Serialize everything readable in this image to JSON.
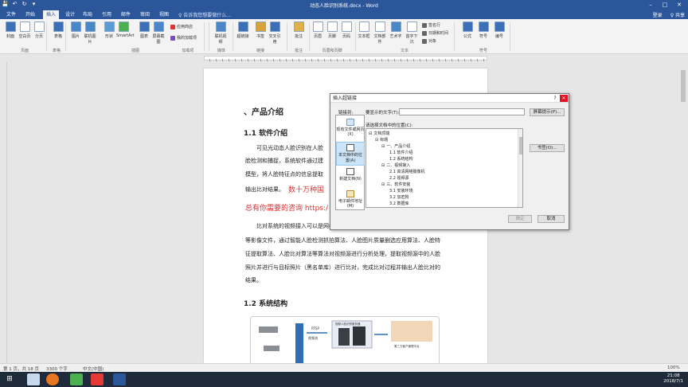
{
  "window": {
    "title": "动态人脸识别系统.docx - Word",
    "controls": {
      "minimize": "–",
      "maximize": "□",
      "close": "✕"
    }
  },
  "qat": {
    "save": "💾",
    "undo": "↶",
    "redo": "↻",
    "customize": "▾"
  },
  "tabs": [
    {
      "label": "文件",
      "active": false
    },
    {
      "label": "开始",
      "active": false
    },
    {
      "label": "插入",
      "active": true
    },
    {
      "label": "设计",
      "active": false
    },
    {
      "label": "布局",
      "active": false
    },
    {
      "label": "引用",
      "active": false
    },
    {
      "label": "邮件",
      "active": false
    },
    {
      "label": "审阅",
      "active": false
    },
    {
      "label": "视图",
      "active": false
    }
  ],
  "tell_me": "♀ 告诉我您想要做什么...",
  "account": {
    "login": "登录",
    "share": "♀ 共享"
  },
  "ribbon": {
    "buttons": [
      {
        "label": "封面",
        "color": "#3b6fb6"
      },
      {
        "label": "空白页",
        "color": "#ffffff"
      },
      {
        "label": "分页",
        "color": "#ffffff"
      },
      {
        "label": "表格",
        "color": "#3b6fb6"
      },
      {
        "label": "图片",
        "color": "#4a87c9"
      },
      {
        "label": "联机图片",
        "color": "#4a87c9"
      },
      {
        "label": "形状",
        "color": "#5a9bd5"
      },
      {
        "label": "SmartArt",
        "color": "#4caf50"
      },
      {
        "label": "图表",
        "color": "#3b6fb6"
      },
      {
        "label": "屏幕截图",
        "color": "#4a87c9"
      },
      {
        "label": "联机视频",
        "color": "#4a87c9"
      },
      {
        "label": "超链接",
        "color": "#3b6fb6"
      },
      {
        "label": "书签",
        "color": "#d8a43a"
      },
      {
        "label": "交叉引用",
        "color": "#3b6fb6"
      },
      {
        "label": "批注",
        "color": "#e0b04a"
      },
      {
        "label": "页眉",
        "color": "#ffffff"
      },
      {
        "label": "页脚",
        "color": "#ffffff"
      },
      {
        "label": "页码",
        "color": "#ffffff"
      },
      {
        "label": "文本框",
        "color": "#ffffff"
      },
      {
        "label": "文档部件",
        "color": "#ffffff"
      },
      {
        "label": "艺术字",
        "color": "#4a87c9"
      },
      {
        "label": "首字下沉",
        "color": "#ffffff"
      },
      {
        "label": "公式",
        "color": "#3b6fb6"
      },
      {
        "label": "符号",
        "color": "#3b6fb6"
      },
      {
        "label": "编号",
        "color": "#3b6fb6"
      }
    ],
    "small": {
      "store": "应用商店",
      "addins": "我的加载项",
      "signature": "签名行",
      "datetime": "日期和时间",
      "object": "对象"
    },
    "groups": [
      "页面",
      "表格",
      "插图",
      "加载项",
      "媒体",
      "链接",
      "批注",
      "页眉和页脚",
      "文本",
      "符号"
    ]
  },
  "document": {
    "h1": "、产品介绍",
    "h2a": "1.1 软件介绍",
    "p1": [
      "可见光动态人脸识别在人脸",
      "脸检测和捕捉，系统软件通过建",
      "模型，将人脸特征点的信息提取",
      "输出比对结果。"
    ],
    "red1": "数十万种国",
    "red2": "总有你需要的咨询 https:/",
    "p2": [
      "比对系统的视频接入可以是网络视频流，也可以是本地视频文件或者",
      "等影像文件，通过智能人脸检测抓拍算法、人脸图片质量删选应用算法、人脸特",
      "征提取算法、人脸比对算法等算法对视频源进行分析处理，提取视频源中的人脸",
      "照片并进行与目标照片（黑名单库）进行比对，完成比对过程并输出人脸比对的",
      "结果。"
    ],
    "h2b": "1.2 系统结构",
    "diagram": {
      "rtsp": "RTSP",
      "stream": "视频流",
      "server_caption": "视频人脸识别服务器",
      "platform": "第三方客户管理平台"
    }
  },
  "dialog": {
    "title": "插入超链接",
    "help": "?",
    "close": "✕",
    "link_to": "链接到:",
    "display_text_label": "要显示的文字(T):",
    "display_text_value": "",
    "screen_tip": "屏幕提示(P)...",
    "select_place": "请选择文档中的位置(C):",
    "bookmark": "书签(O)...",
    "ok": "确定",
    "cancel": "取消",
    "nav": [
      {
        "label": "现有文件或网页(X)",
        "selected": false
      },
      {
        "label": "本文档中的位置(A)",
        "selected": true
      },
      {
        "label": "新建文档(N)",
        "selected": false
      },
      {
        "label": "电子邮件地址(M)",
        "selected": false
      }
    ],
    "tree": [
      {
        "label": "文档顶端",
        "indent": 0,
        "toggle": "⊟"
      },
      {
        "label": "标题",
        "indent": 1,
        "toggle": "⊟"
      },
      {
        "label": "一、产品介绍",
        "indent": 2,
        "toggle": "⊟"
      },
      {
        "label": "1.1 软件介绍",
        "indent": 3,
        "toggle": ""
      },
      {
        "label": "1.2 系统结构",
        "indent": 3,
        "toggle": ""
      },
      {
        "label": "二、视频接入",
        "indent": 2,
        "toggle": "⊟"
      },
      {
        "label": "2.1 高清网络摄像机",
        "indent": 3,
        "toggle": ""
      },
      {
        "label": "2.2 视频源",
        "indent": 3,
        "toggle": ""
      },
      {
        "label": "三、软件安装",
        "indent": 2,
        "toggle": "⊟"
      },
      {
        "label": "3.1 安装环境",
        "indent": 3,
        "toggle": ""
      },
      {
        "label": "3.2 加密狗",
        "indent": 3,
        "toggle": ""
      },
      {
        "label": "3.2 数据库",
        "indent": 3,
        "toggle": ""
      }
    ]
  },
  "status": {
    "page": "第 1 页，共 18 页",
    "words": "3300 个字",
    "lang": "中文(中国)",
    "zoom": "100%"
  },
  "taskbar": {
    "time": "21:08",
    "date": "2018/7/1"
  }
}
